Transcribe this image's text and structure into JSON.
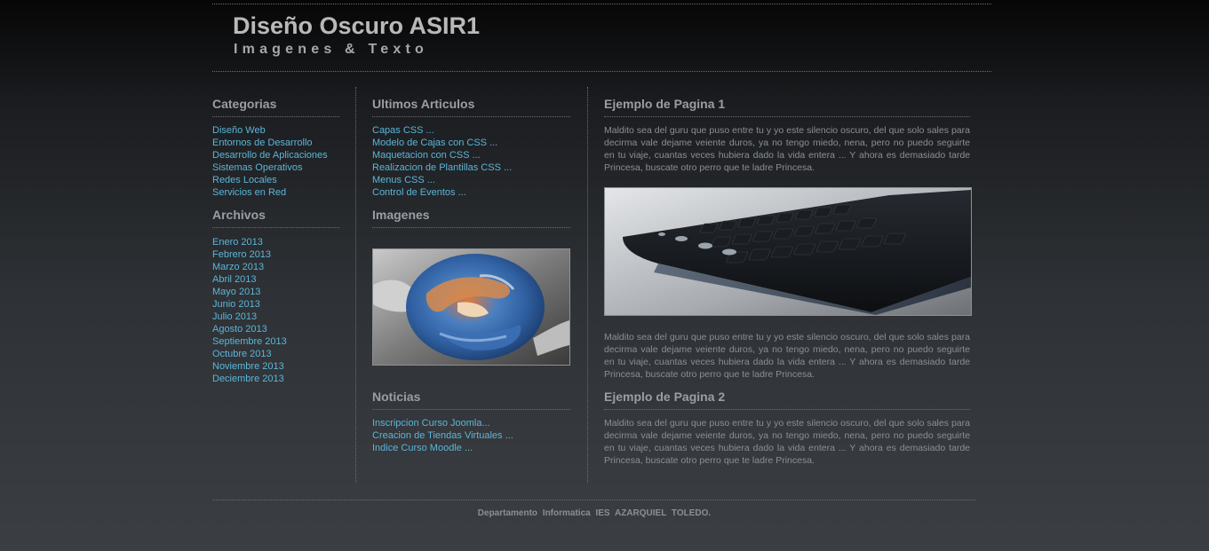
{
  "header": {
    "title": "Diseño Oscuro ASIR1",
    "subtitle": "Imagenes & Texto"
  },
  "categorias": {
    "heading": "Categorias",
    "items": [
      "Diseño Web",
      "Entornos de Desarrollo",
      "Desarrollo de Aplicaciones",
      "Sistemas Operativos",
      "Redes Locales",
      "Servicios en Red"
    ]
  },
  "archivos": {
    "heading": "Archivos",
    "items": [
      "Enero 2013",
      "Febrero 2013",
      "Marzo 2013",
      "Abril 2013",
      "Mayo 2013",
      "Junio 2013",
      "Julio 2013",
      "Agosto 2013",
      "Septiembre 2013",
      "Octubre 2013",
      "Noviembre 2013",
      "Deciembre 2013"
    ]
  },
  "ultimos": {
    "heading": "Ultimos Articulos",
    "items": [
      "Capas CSS ...",
      "Modelo de Cajas con CSS ...",
      "Maquetacion con CSS ...",
      "Realizacion de Plantillas CSS ...",
      "Menus CSS ...",
      "Control de Eventos ..."
    ]
  },
  "imagenes": {
    "heading": "Imagenes",
    "image_icon": "hands-holding-globe-image"
  },
  "noticias": {
    "heading": "Noticias",
    "items": [
      "Inscripcion Curso Joomla...",
      "Creacion de Tiendas Virtuales ...",
      "Indice Curso Moodle ..."
    ]
  },
  "pagina1": {
    "heading": "Ejemplo de Pagina 1",
    "para_top": "Maldito sea del guru que puso entre tu y yo este silencio oscuro, del que solo sales para decirma vale dejame veiente duros, ya no tengo miedo, nena, pero no puedo seguirte en tu viaje, cuantas veces hubiera dado la vida entera ... Y ahora es demasiado tarde Princesa, buscate otro perro que te ladre Princesa.",
    "image_icon": "keyboard-image",
    "para_bottom": "Maldito sea del guru que puso entre tu y yo este silencio oscuro, del que solo sales para decirma vale dejame veiente duros, ya no tengo miedo, nena, pero no puedo seguirte en tu viaje, cuantas veces hubiera dado la vida entera ... Y ahora es demasiado tarde Princesa, buscate otro perro que te ladre Princesa."
  },
  "pagina2": {
    "heading": "Ejemplo de Pagina 2",
    "para": "Maldito sea del guru que puso entre tu y yo este silencio oscuro, del que solo sales para decirma vale dejame veiente duros, ya no tengo miedo, nena, pero no puedo seguirte en tu viaje, cuantas veces hubiera dado la vida entera ... Y ahora es demasiado tarde Princesa, buscate otro perro que te ladre Princesa."
  },
  "footer": {
    "text": "Departamento Informatica IES AZARQUIEL TOLEDO."
  },
  "colors": {
    "link": "#5bb6d9",
    "heading": "#9a9ea4",
    "body_text": "#8b8f94"
  }
}
